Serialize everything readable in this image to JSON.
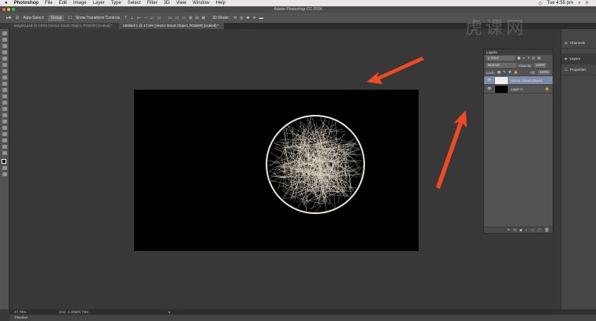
{
  "menubar": {
    "app": "Photoshop",
    "items": [
      "File",
      "Edit",
      "Image",
      "Layer",
      "Type",
      "Select",
      "Filter",
      "3D",
      "View",
      "Window",
      "Help"
    ],
    "clock": "Tue 4:55 pm"
  },
  "window": {
    "title": "Adobe Photoshop CC 2014"
  },
  "options": {
    "auto_select": "Auto-Select:",
    "auto_select_value": "Group",
    "show_transform": "Show Transform Controls",
    "mode_3d": "3D Mode:"
  },
  "tabs": [
    {
      "label": "tangled.psd @ 133% (Vector Smart Object, RGB/8#) [scaled] *"
    },
    {
      "label": "Untitled-1 @ 47.8% (Vector Smart Object, RGB/8#) [scaled] *"
    }
  ],
  "layers_panel": {
    "title": "Layers",
    "kind": "ρ Kind",
    "blend": "Normal",
    "opacity_label": "Opacity:",
    "opacity": "100%",
    "lock_label": "Lock:",
    "fill_label": "Fill:",
    "fill": "100%",
    "layers": [
      {
        "name": "Vector Smart Object",
        "selected": true
      },
      {
        "name": "Layer 0",
        "selected": false
      }
    ]
  },
  "dock": {
    "items": [
      "Channels",
      "Layers",
      "Properties"
    ]
  },
  "status": {
    "zoom": "47.76%",
    "doc": "Doc: 4.40M/5.74M"
  },
  "timeline": {
    "label": "Timeline"
  },
  "watermark": "虎课网",
  "colors": {
    "arrow": "#f04a24",
    "selected_layer": "#7e8da7"
  }
}
